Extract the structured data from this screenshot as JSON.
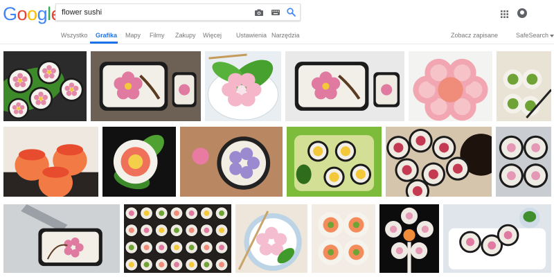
{
  "brand": {
    "letters": [
      {
        "char": "G",
        "color": "#4285F4"
      },
      {
        "char": "o",
        "color": "#EA4335"
      },
      {
        "char": "o",
        "color": "#FBBC05"
      },
      {
        "char": "g",
        "color": "#4285F4"
      },
      {
        "char": "l",
        "color": "#34A853"
      },
      {
        "char": "e",
        "color": "#EA4335"
      }
    ]
  },
  "search": {
    "query": "flower sushi",
    "icons": [
      "camera-icon",
      "keyboard-icon",
      "search-icon"
    ]
  },
  "header": {
    "icons": [
      "apps-icon",
      "account-icon"
    ]
  },
  "tabs": [
    {
      "label": "Wszystko",
      "active": false
    },
    {
      "label": "Grafika",
      "active": true
    },
    {
      "label": "Mapy",
      "active": false
    },
    {
      "label": "Filmy",
      "active": false
    },
    {
      "label": "Zakupy",
      "active": false
    },
    {
      "label": "Więcej",
      "active": false
    },
    {
      "label": "Ustawienia",
      "active": false
    },
    {
      "label": "Narzędzia",
      "active": false
    }
  ],
  "tools": {
    "saved_label": "Zobacz zapisane",
    "safesearch_label": "SafeSearch"
  },
  "colors": {
    "accent": "#1a73e8",
    "tab_text": "#777777"
  },
  "results": [
    {
      "kind": "flower-rolls-leaf",
      "bg": "#2b2b2b"
    },
    {
      "kind": "sakura-roll-branch",
      "bg": "#6d6054"
    },
    {
      "kind": "pink-flower-leaf",
      "bg": "#e8eef1"
    },
    {
      "kind": "sakura-roll-branch",
      "bg": "#e9e9e9"
    },
    {
      "kind": "pink-salmon-rolls",
      "bg": "#f3f3f1"
    },
    {
      "kind": "green-rolls-chopsticks",
      "bg": "#e9e3d6"
    },
    {
      "kind": "salmon-cups",
      "bg": "#efe8e0"
    },
    {
      "kind": "rose-roll-leaf",
      "bg": "#111111"
    },
    {
      "kind": "flower-roll-plate",
      "bg": "#b98863"
    },
    {
      "kind": "bento-flowers",
      "bg": "#7cbc3a"
    },
    {
      "kind": "tuna-rolls-sauce",
      "bg": "#d6c5ad"
    },
    {
      "kind": "grey-flower-rolls",
      "bg": "#c9ccd1"
    },
    {
      "kind": "knife-sakura-roll",
      "bg": "#cfd2d5"
    },
    {
      "kind": "many-rolls",
      "bg": "#24201d"
    },
    {
      "kind": "pink-flower-chopsticks",
      "bg": "#eee6da"
    },
    {
      "kind": "salmon-flower-rolls",
      "bg": "#f3ece4"
    },
    {
      "kind": "flower-shape-black",
      "bg": "#0c0c0c"
    },
    {
      "kind": "rolls-plate-bowls",
      "bg": "#dfe5ea"
    }
  ]
}
